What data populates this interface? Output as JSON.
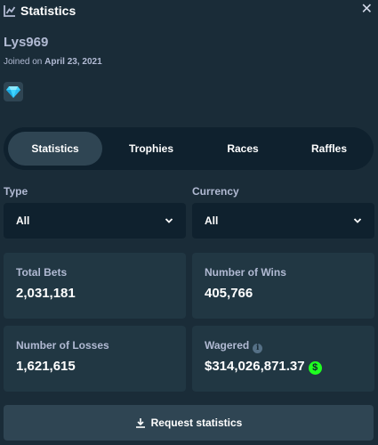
{
  "header": {
    "title": "Statistics",
    "close_icon": "close-icon",
    "title_icon": "chart-icon"
  },
  "profile": {
    "username": "Lys969",
    "joined_prefix": "Joined on",
    "joined_date": "April 23, 2021",
    "badge_icon": "diamond-icon"
  },
  "tabs": [
    {
      "label": "Statistics",
      "active": true
    },
    {
      "label": "Trophies",
      "active": false
    },
    {
      "label": "Races",
      "active": false
    },
    {
      "label": "Raffles",
      "active": false
    }
  ],
  "filters": {
    "type": {
      "label": "Type",
      "value": "All"
    },
    "currency": {
      "label": "Currency",
      "value": "All"
    }
  },
  "stats": {
    "total_bets": {
      "label": "Total Bets",
      "value": "2,031,181"
    },
    "wins": {
      "label": "Number of Wins",
      "value": "405,766"
    },
    "losses": {
      "label": "Number of Losses",
      "value": "1,621,615"
    },
    "wagered": {
      "label": "Wagered",
      "value": "$314,026,871.37"
    }
  },
  "actions": {
    "request_label": "Request statistics"
  },
  "colors": {
    "background": "#1a2c38",
    "card": "#213743",
    "input": "#0f212e",
    "accent_green": "#1fff20",
    "muted_text": "#b1bad3"
  }
}
